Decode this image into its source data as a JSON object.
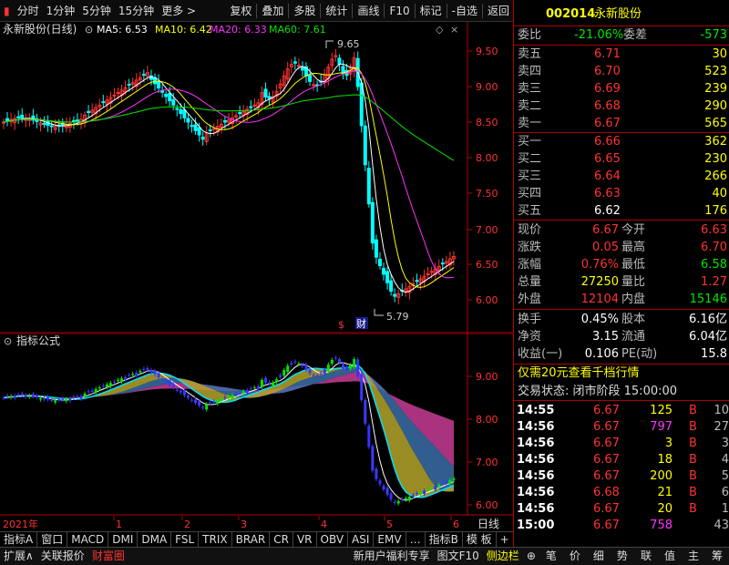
{
  "toolbar": {
    "left": [
      "分时",
      "1分钟",
      "5分钟",
      "15分钟",
      "更多 >"
    ],
    "right": [
      "复权",
      "叠加",
      "多股",
      "统计",
      "画线",
      "F10",
      "标记",
      "-自选",
      "返回"
    ]
  },
  "main": {
    "title": "永新股份(日线)",
    "ma5": "MA5: 6.53",
    "ma10": "MA10: 6.42",
    "ma20": "MA20: 6.33",
    "ma60": "MA60: 7.61",
    "high_label": "9.65",
    "low_label": "5.79",
    "marker_s": "$",
    "marker_cai": "财",
    "yticks": [
      "9.50",
      "9.00",
      "8.50",
      "8.00",
      "7.50",
      "7.00",
      "6.50",
      "6.00"
    ]
  },
  "indicator": {
    "title": "指标公式",
    "yticks": [
      "9.00",
      "8.00",
      "7.00",
      "6.00"
    ]
  },
  "xaxis": {
    "year": "2021年",
    "months": [
      "1",
      "2",
      "3",
      "4",
      "5",
      "6"
    ],
    "period": "日线"
  },
  "tabs1": [
    "指标A",
    "窗口",
    "MACD",
    "DMI",
    "DMA",
    "FSL",
    "TRIX",
    "BRAR",
    "CR",
    "VR",
    "OBV",
    "ASI",
    "EMV",
    "…",
    "指标B",
    "模 板",
    "+",
    "−"
  ],
  "tabs2": [
    "扩展∧",
    "关联报价",
    "财富圈"
  ],
  "tabs2_right": [
    "新用户福利专享",
    "图文F10",
    "侧边栏"
  ],
  "side_tabs": [
    "笔",
    "价",
    "细",
    "势",
    "联",
    "值",
    "主",
    "筹"
  ],
  "quote": {
    "code": "002014",
    "name": "永新股份",
    "weibi_label": "委比",
    "weibi": "-21.06%",
    "weicha_label": "委差",
    "weicha": "-573",
    "sells": [
      {
        "label": "卖五",
        "price": "6.71",
        "vol": "30"
      },
      {
        "label": "卖四",
        "price": "6.70",
        "vol": "523"
      },
      {
        "label": "卖三",
        "price": "6.69",
        "vol": "239"
      },
      {
        "label": "卖二",
        "price": "6.68",
        "vol": "290"
      },
      {
        "label": "卖一",
        "price": "6.67",
        "vol": "565"
      }
    ],
    "buys": [
      {
        "label": "买一",
        "price": "6.66",
        "vol": "362"
      },
      {
        "label": "买二",
        "price": "6.65",
        "vol": "230"
      },
      {
        "label": "买三",
        "price": "6.64",
        "vol": "266"
      },
      {
        "label": "买四",
        "price": "6.63",
        "vol": "40"
      },
      {
        "label": "买五",
        "price": "6.62",
        "vol": "176"
      }
    ],
    "stats": [
      {
        "l1": "现价",
        "v1": "6.67",
        "l2": "今开",
        "v2": "6.63"
      },
      {
        "l1": "涨跌",
        "v1": "0.05",
        "l2": "最高",
        "v2": "6.70"
      },
      {
        "l1": "涨幅",
        "v1": "0.76%",
        "l2": "最低",
        "v2": "6.58"
      },
      {
        "l1": "总量",
        "v1": "27250",
        "l2": "量比",
        "v2": "1.27"
      },
      {
        "l1": "外盘",
        "v1": "12104",
        "l2": "内盘",
        "v2": "15146"
      }
    ],
    "stats2": [
      {
        "l1": "换手",
        "v1": "0.45%",
        "l2": "股本",
        "v2": "6.16亿"
      },
      {
        "l1": "净资",
        "v1": "3.15",
        "l2": "流通",
        "v2": "6.04亿"
      },
      {
        "l1": "收益(一)",
        "v1": "0.106",
        "l2": "PE(动)",
        "v2": "15.8"
      }
    ],
    "promo": "仅需20元查看千档行情",
    "status": "交易状态: 闭市阶段 15:00:00",
    "trades": [
      {
        "t": "14:55",
        "p": "6.67",
        "v": "125",
        "d": "B",
        "n": "10"
      },
      {
        "t": "14:56",
        "p": "6.67",
        "v": "797",
        "d": "B",
        "n": "27"
      },
      {
        "t": "14:56",
        "p": "6.67",
        "v": "3",
        "d": "B",
        "n": "3"
      },
      {
        "t": "14:56",
        "p": "6.67",
        "v": "18",
        "d": "B",
        "n": "4"
      },
      {
        "t": "14:56",
        "p": "6.67",
        "v": "200",
        "d": "B",
        "n": "5"
      },
      {
        "t": "14:56",
        "p": "6.68",
        "v": "21",
        "d": "B",
        "n": "6"
      },
      {
        "t": "14:56",
        "p": "6.67",
        "v": "20",
        "d": "B",
        "n": "1"
      },
      {
        "t": "15:00",
        "p": "6.67",
        "v": "758",
        "d": "",
        "n": "43"
      }
    ]
  },
  "colors": {
    "up": "#ff3232",
    "down": "#00e600",
    "ma5": "#ffffff",
    "ma10": "#ffff00",
    "ma20": "#ff33ff",
    "ma60": "#00e600",
    "axis": "#b00000"
  }
}
